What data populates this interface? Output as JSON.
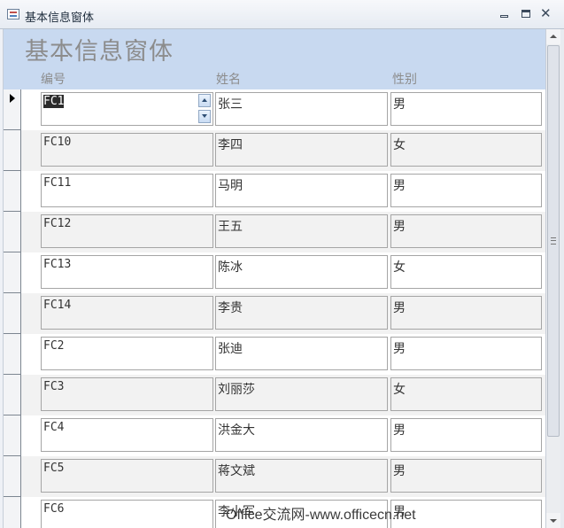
{
  "window": {
    "title": "基本信息窗体"
  },
  "form": {
    "title": "基本信息窗体",
    "columns": {
      "id": "编号",
      "name": "姓名",
      "gender": "性别"
    }
  },
  "records": [
    {
      "id": "FC1",
      "name": "张三",
      "gender": "男"
    },
    {
      "id": "FC10",
      "name": "李四",
      "gender": "女"
    },
    {
      "id": "FC11",
      "name": "马明",
      "gender": "男"
    },
    {
      "id": "FC12",
      "name": "王五",
      "gender": "男"
    },
    {
      "id": "FC13",
      "name": "陈冰",
      "gender": "女"
    },
    {
      "id": "FC14",
      "name": "李贵",
      "gender": "男"
    },
    {
      "id": "FC2",
      "name": "张迪",
      "gender": "男"
    },
    {
      "id": "FC3",
      "name": "刘丽莎",
      "gender": "女"
    },
    {
      "id": "FC4",
      "name": "洪金大",
      "gender": "男"
    },
    {
      "id": "FC5",
      "name": "蒋文斌",
      "gender": "男"
    },
    {
      "id": "FC6",
      "name": "李小军",
      "gender": "男"
    }
  ],
  "watermark": "Office交流网-www.officecn.net"
}
